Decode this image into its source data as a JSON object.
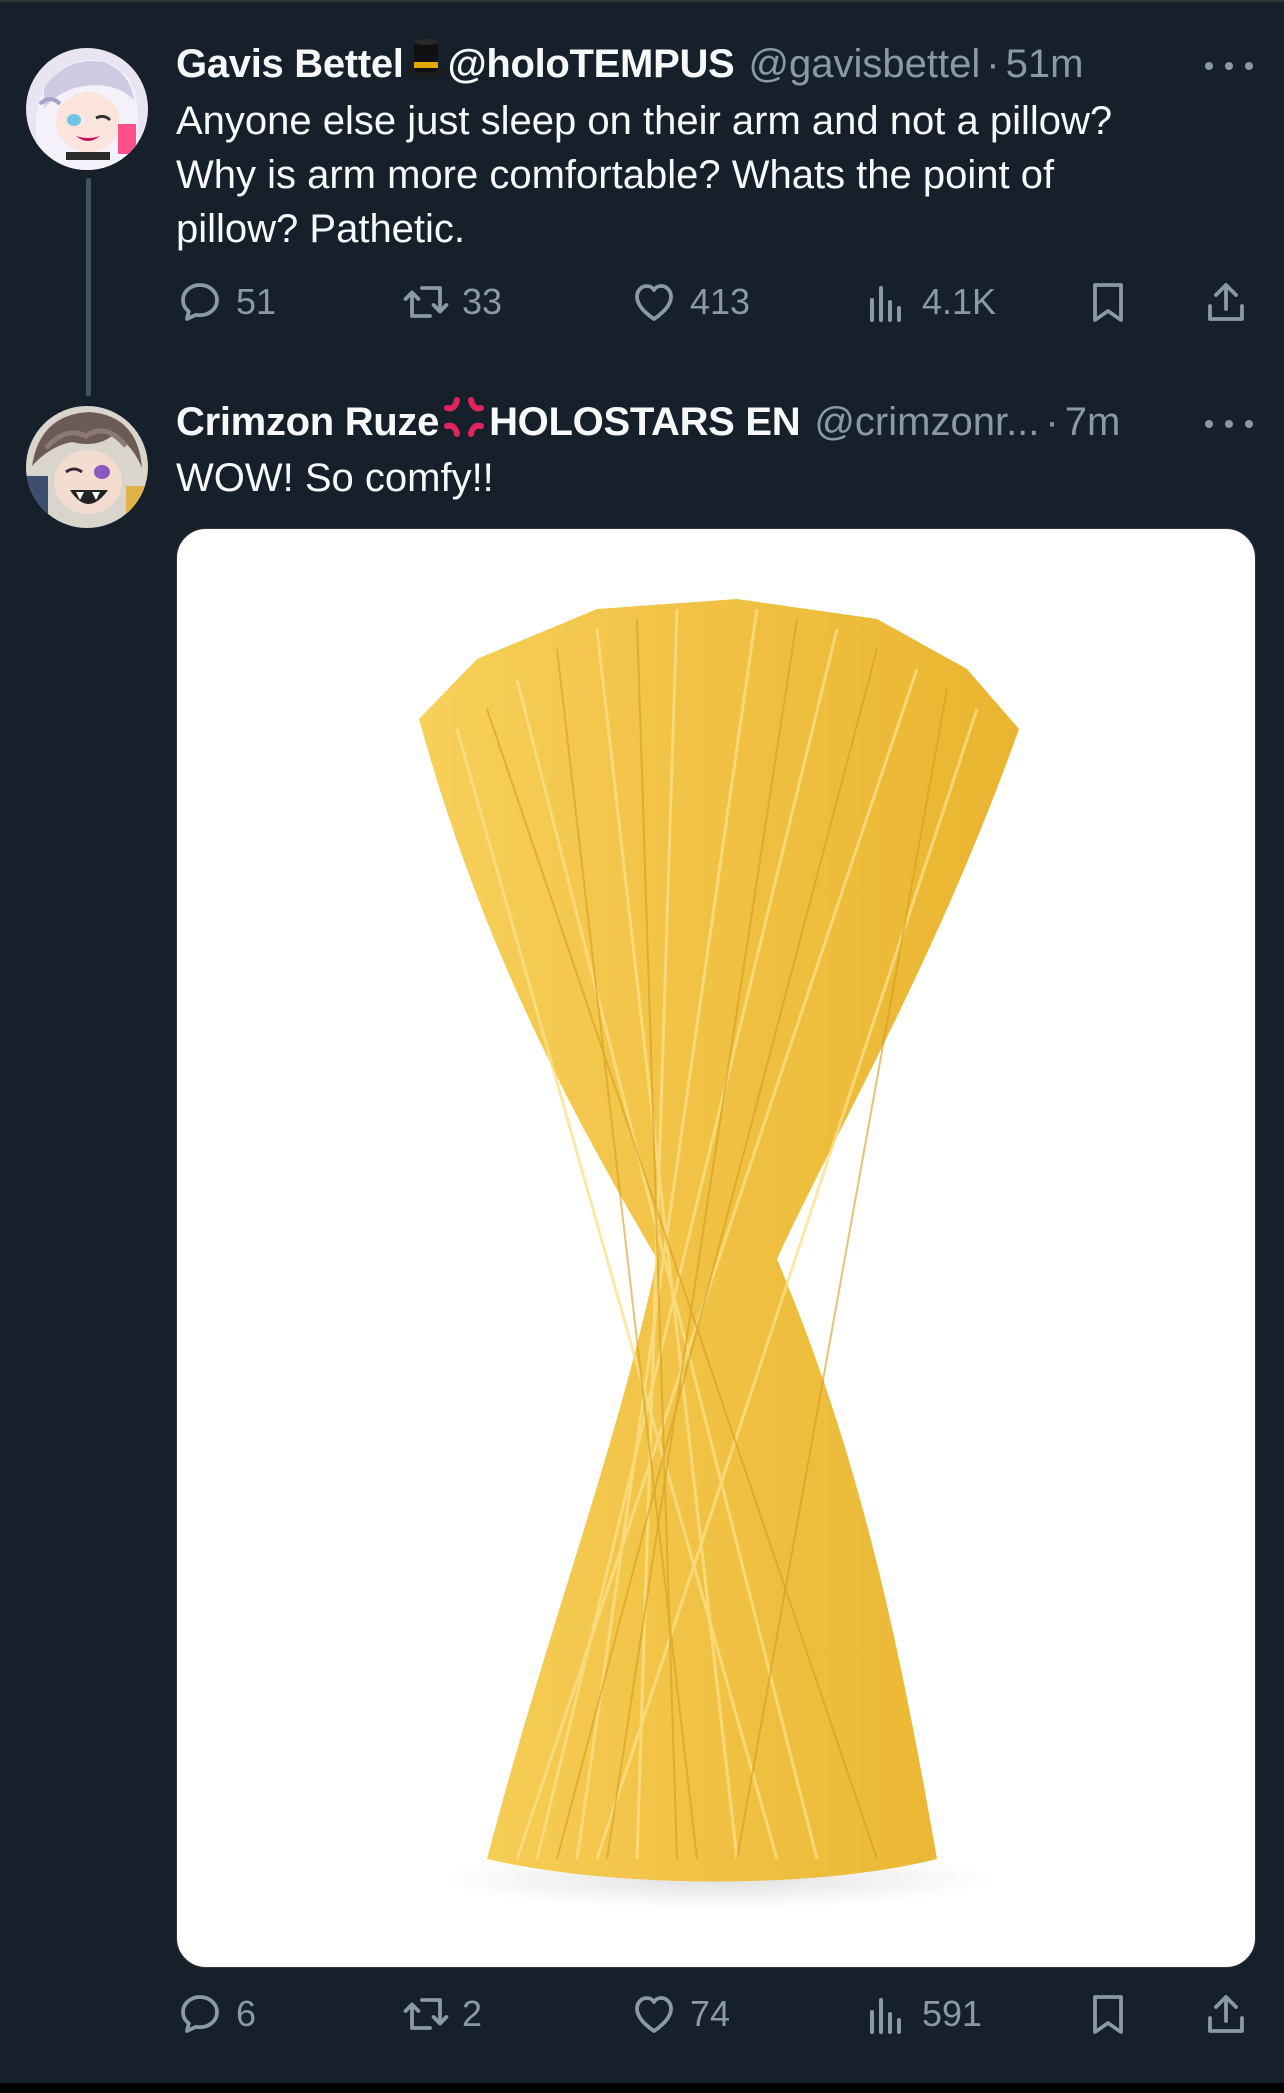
{
  "tweets": [
    {
      "display_name": "Gavis Bettel",
      "name_emoji": "top-hat",
      "name_suffix": "@holoTEMPUS",
      "handle": "@gavisbettel",
      "separator": "·",
      "time": "51m",
      "text": "Anyone else just sleep on their arm and not a pillow?\nWhy is arm more comfortable? Whats the point of\npillow? Pathetic.",
      "stats": {
        "replies": "51",
        "retweets": "33",
        "likes": "413",
        "views": "4.1K"
      }
    },
    {
      "display_name": "Crimzon Ruze",
      "name_emoji": "anger-symbol",
      "name_suffix": "HOLOSTARS EN",
      "handle": "@crimzonr...",
      "separator": "·",
      "time": "7m",
      "text": "WOW!  So comfy!!",
      "media": "spaghetti-bundle-image",
      "stats": {
        "replies": "6",
        "retweets": "2",
        "likes": "74",
        "views": "591"
      }
    }
  ],
  "colors": {
    "background": "#15202b",
    "primary_text": "#f7f9f9",
    "secondary_text": "#8b98a5",
    "thread_line": "#425364",
    "anger_emoji": "#e0245e"
  },
  "icons": [
    "reply-icon",
    "retweet-icon",
    "like-icon",
    "views-icon",
    "bookmark-icon",
    "share-icon",
    "more-icon"
  ]
}
